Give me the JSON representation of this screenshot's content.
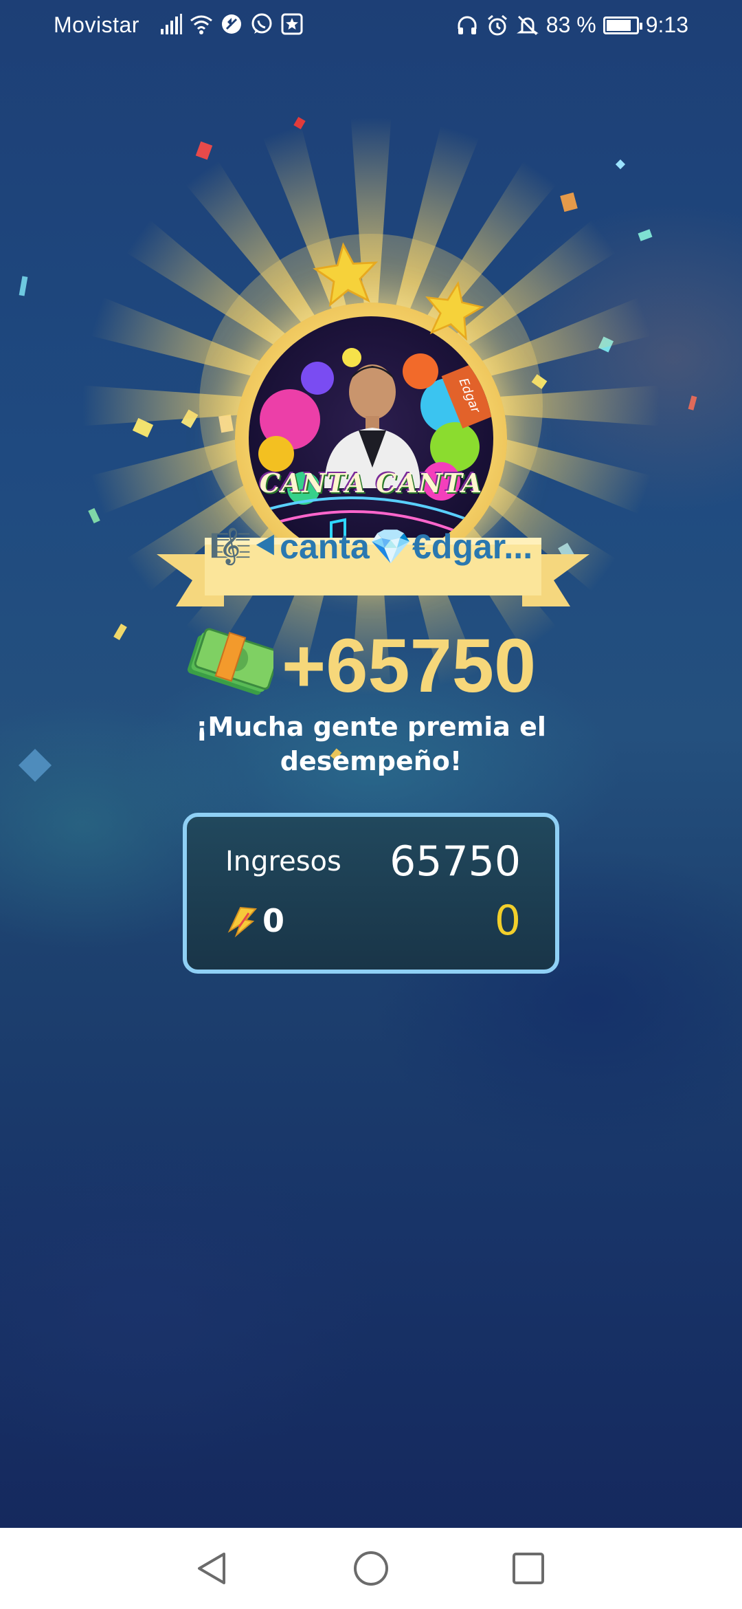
{
  "status_bar": {
    "carrier": "Movistar",
    "battery_text": "83 %",
    "battery_level": 0.83,
    "time": "9:13",
    "left_icons": [
      "signal-icon",
      "wifi-icon",
      "data-saver-icon",
      "whatsapp-icon",
      "app-star-icon"
    ],
    "right_icons": [
      "headset-icon",
      "alarm-icon",
      "mute-icon",
      "battery-icon"
    ]
  },
  "profile": {
    "avatar_text": "CANTA CANTA",
    "avatar_stamp": "Edgar",
    "username": "🎼⯇canta💎€dgar..."
  },
  "reward": {
    "amount": "+65750",
    "message": "¡Mucha gente premia el desempeño!"
  },
  "earnings": {
    "label": "Ingresos",
    "value": "65750",
    "bonus_count": "0",
    "bonus_value": "0"
  },
  "colors": {
    "accent_gold": "#f6d77a",
    "panel_border": "#8fd0f5",
    "bonus_yellow": "#f2cf2b",
    "username_blue": "#2a78b0"
  },
  "nav_bar": {
    "buttons": [
      "back-icon",
      "home-icon",
      "recents-icon"
    ]
  }
}
